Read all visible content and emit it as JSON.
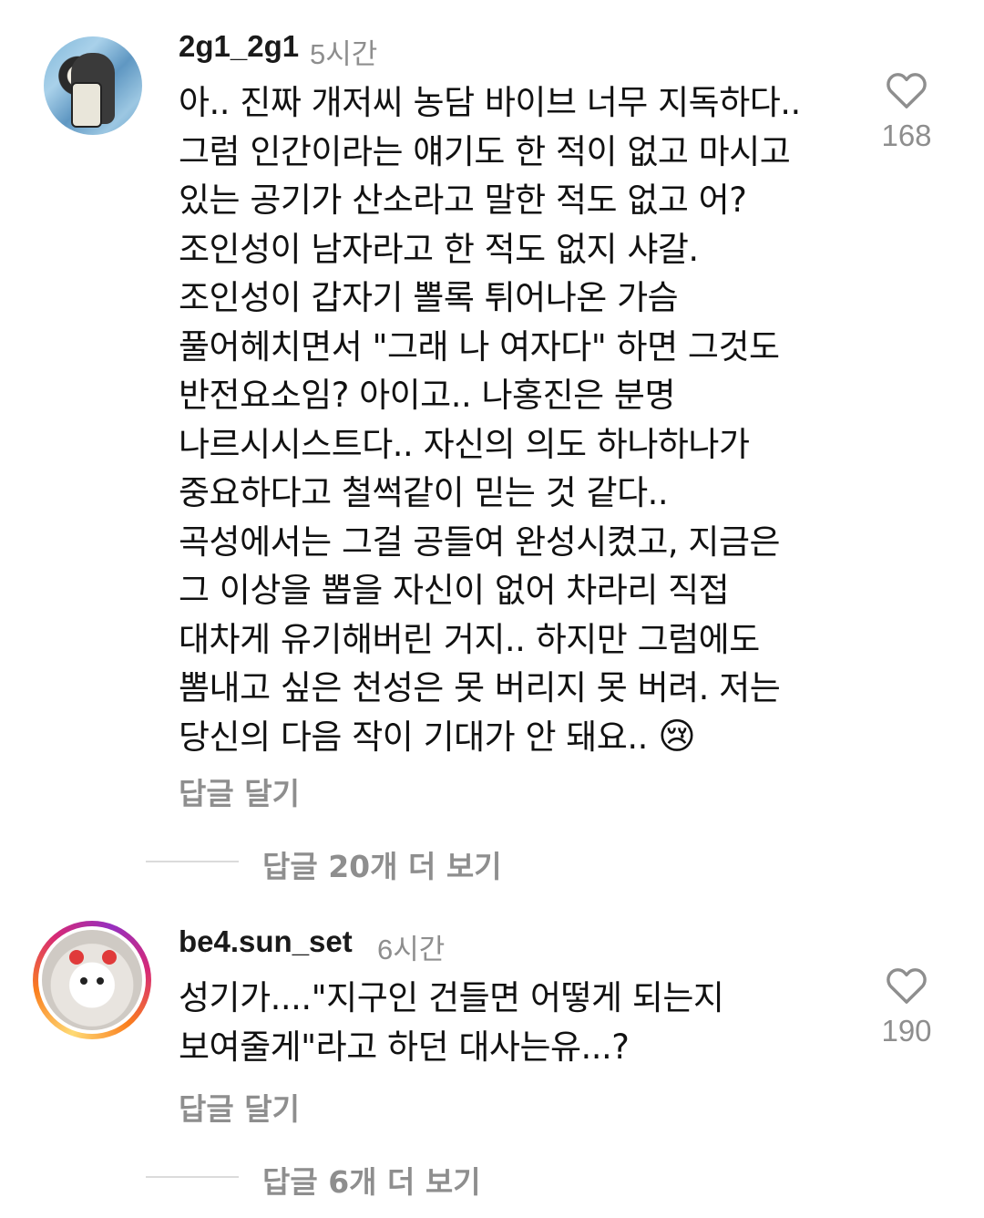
{
  "comments": [
    {
      "username": "2g1_2g1",
      "time": "5시간",
      "text_main": "아.. 진짜 개저씨 농담 바이브 너무 지독하다..\n그럼 인간이라는 얘기도 한 적이 없고 마시고\n있는 공기가 산소라고 말한 적도 없고 어?\n조인성이 남자라고 한 적도 없지 샤갈.\n조인성이 갑자기 뽈록 튀어나온 가슴\n풀어헤치면서 \"그래 나 여자다\" 하면 그것도\n반전요소임? 아이고.. 나홍진은 분명\n나르시시스트다.. 자신의 의도 하나하나가\n중요하다고 철썩같이 믿는 것 같다..\n곡성에서는 그걸 공들여 완성시켰고, 지금은\n그 이상을 뽑을 자신이 없어 차라리 직접\n대차게 유기해버린 거지.. 하지만 그럼에도\n뽐내고 싶은 천성은 못 버리지 못 버려. 저는\n당신의 다음 작이 기대가 안 돼요.. ",
      "emoji": "😢",
      "reply_label": "답글 달기",
      "like_count": "168",
      "more_replies": "답글 20개 더 보기"
    },
    {
      "username": "be4.sun_set",
      "time": "6시간",
      "text_main": "성기가....\"지구인 건들면 어떻게 되는지\n보여줄게\"라고 하던 대사는유...?",
      "reply_label": "답글 달기",
      "like_count": "190",
      "more_replies": "답글 6개 더 보기"
    }
  ],
  "icons": {
    "like": "heart-outline-icon"
  },
  "colors": {
    "secondary_text": "#8e8e8e",
    "story_ring": [
      "#feda75",
      "#fa7e1e",
      "#d62976",
      "#962fbf"
    ]
  }
}
